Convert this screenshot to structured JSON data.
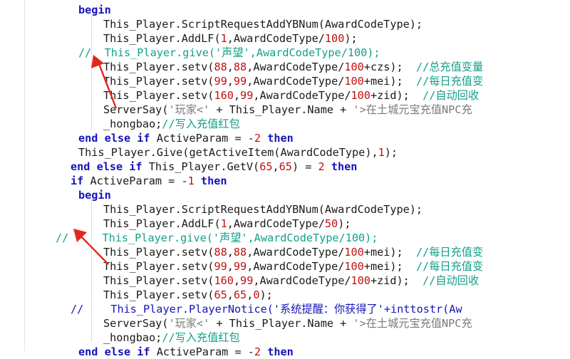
{
  "lines": [
    "begin",
    "This_Player.ScriptRequestAddYBNum(AwardCodeType);",
    "This_Player.AddLF(1,AwardCodeType/100);",
    "//  This_Player.give('声望',AwardCodeType/100);",
    "This_Player.setv(88,88,AwardCodeType/100+czs);",
    "//总充值变量",
    "This_Player.setv(99,99,AwardCodeType/100+mei);",
    "//每日充值变",
    "This_Player.setv(160,99,AwardCodeType/100+zid);",
    "//自动回收",
    "ServerSay('玩家<' + This_Player.Name + '>在土城元宝充值NPC充",
    "_hongbao;//写入充值红包",
    "end else if ActiveParam = -2 then",
    "This_Player.Give(getActiveItem(AwardCodeType),1);",
    "end else if This_Player.GetV(65,65) = 2 then",
    "if ActiveParam = -1 then",
    "begin",
    "This_Player.ScriptRequestAddYBNum(AwardCodeType);",
    "This_Player.AddLF(1,AwardCodeType/50);",
    "// This_Player.give('声望',AwardCodeType/100);",
    "This_Player.setv(88,88,AwardCodeType/100+mei);",
    "//每日充值变",
    "This_Player.setv(99,99,AwardCodeType/100+mei);",
    "//每日充值变",
    "This_Player.setv(160,99,AwardCodeType/100+zid);",
    "//自动回收",
    "This_Player.setv(65,65,0);",
    "//   This_Player.PlayerNotice('系统提醒：你获得了'+inttostr(Aw",
    "ServerSay('玩家<' + This_Player.Name + '>在土城元宝充值NPC充",
    "_hongbao;//写入充值红包",
    "end else if ActiveParam = -2 then"
  ],
  "colors": {
    "keyword": "#1515b8",
    "number": "#c01010",
    "string": "#7a7a7a",
    "comment": "#12a08a",
    "arrow": "#e0281e"
  },
  "annotations": [
    "red-arrow",
    "red-arrow"
  ]
}
